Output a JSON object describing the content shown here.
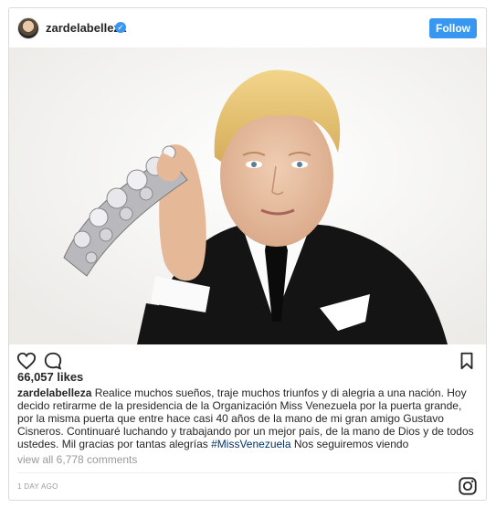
{
  "post": {
    "username": "zardelabelleza",
    "follow_label": "Follow",
    "likes": "66,057 likes",
    "caption_user": "zardelabelleza",
    "caption_text": "Realice muchos sueños, traje muchos triunfos y di alegria a una nación. Hoy decido retirarme de la presidencia de la Organización Miss Venezuela por la puerta grande, por la misma puerta que entre hace casi 40 años de la mano de mi gran amigo Gustavo Cisneros. Continuaré luchando y trabajando por un mejor país, de la mano de Dios y de todos ustedes. Mil gracias por tantas alegrías",
    "hashtag": "#MissVenezuela",
    "caption_end": "Nos seguiremos viendo",
    "view_comments": "view all 6,778 comments",
    "timestamp": "1 DAY AGO"
  },
  "icons": {
    "verified": "verified-badge-icon",
    "like": "heart-icon",
    "comment": "comment-bubble-icon",
    "save": "bookmark-icon",
    "brand": "instagram-icon"
  },
  "colors": {
    "accent": "#3897f0",
    "hashtag": "#003569",
    "muted": "#999999",
    "border": "#dbdbdb"
  }
}
